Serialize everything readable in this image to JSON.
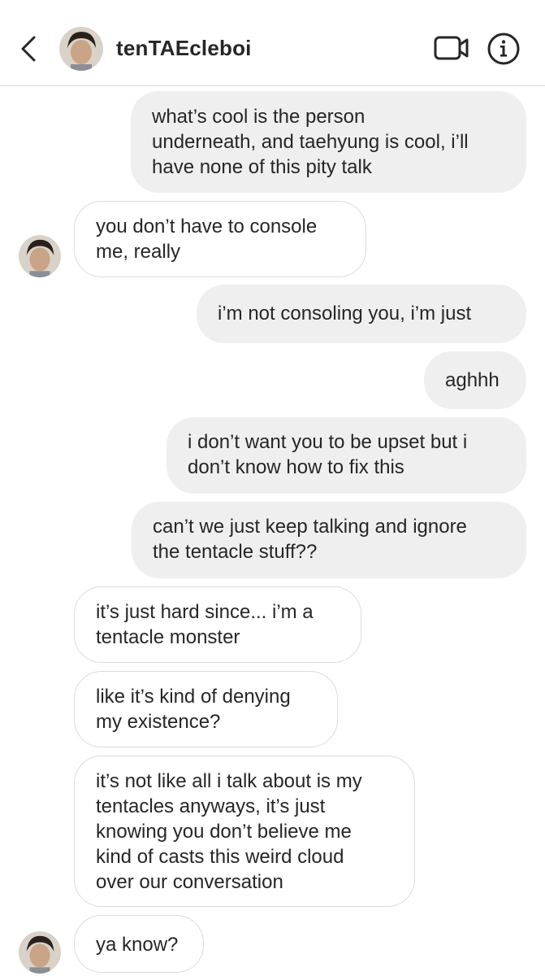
{
  "header": {
    "username": "tenTAEcleboi"
  },
  "icons": {
    "back": "chevron-left-icon",
    "video": "video-camera-icon",
    "info": "info-icon"
  },
  "colors": {
    "outgoing_bubble": "#efefef",
    "incoming_border": "#dbdbdb",
    "text": "#262626"
  },
  "messages": [
    {
      "side": "out",
      "text": "what’s cool is the person\nunderneath, and taehyung is cool, i’ll\nhave none of this pity talk"
    },
    {
      "side": "in",
      "text": "you don’t have to console\nme, really"
    },
    {
      "side": "out",
      "text": "i’m not consoling you, i’m just"
    },
    {
      "side": "out",
      "text": "aghhh"
    },
    {
      "side": "out",
      "text": "i don’t want you to be upset but i\ndon’t know how to fix this"
    },
    {
      "side": "out",
      "text": "can’t we just keep talking and ignore\nthe tentacle stuff??"
    },
    {
      "side": "in",
      "text": "it’s just hard since... i’m a\ntentacle monster"
    },
    {
      "side": "in",
      "text": "like it’s kind of denying\nmy existence?"
    },
    {
      "side": "in",
      "text": "it’s not like all i talk about is my\ntentacles anyways, it’s just\nknowing you don’t believe me\nkind of casts this weird cloud\nover our conversation"
    },
    {
      "side": "in",
      "text": "ya know?"
    }
  ]
}
